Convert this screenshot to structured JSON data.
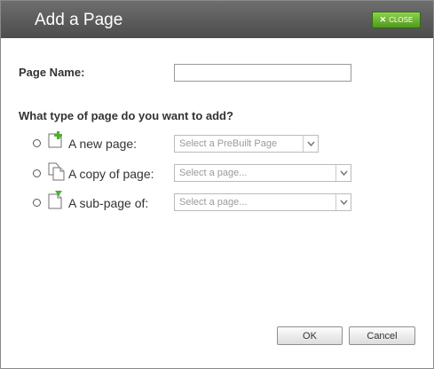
{
  "dialog": {
    "title": "Add a Page",
    "close_label": "CLOSE",
    "close_icon": "x-icon"
  },
  "form": {
    "page_name_label": "Page Name:",
    "page_name_value": "",
    "question": "What type of page do you want to add?",
    "options": [
      {
        "label": "A new page:",
        "icon": "new-page-icon",
        "select_value": "Select a PreBuilt Page"
      },
      {
        "label": "A copy of page:",
        "icon": "copy-page-icon",
        "select_value": "Select a page..."
      },
      {
        "label": "A sub-page of:",
        "icon": "sub-page-icon",
        "select_value": "Select a page..."
      }
    ]
  },
  "footer": {
    "ok_label": "OK",
    "cancel_label": "Cancel"
  },
  "colors": {
    "titlebar": "#5c5c5c",
    "close_button": "#6db33f",
    "icon_accent": "#4caf32"
  }
}
